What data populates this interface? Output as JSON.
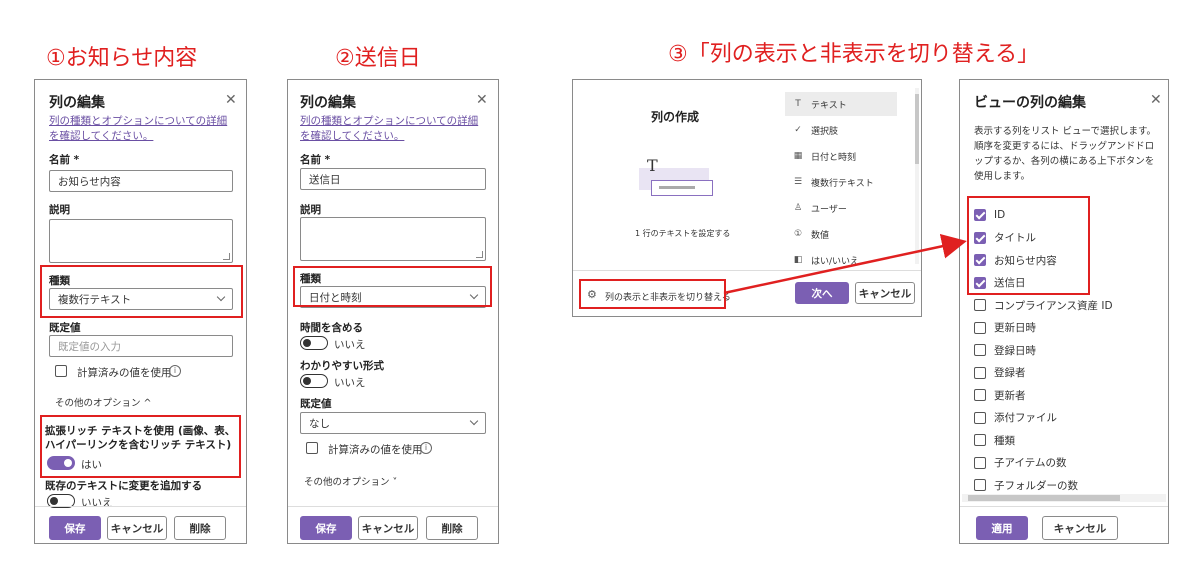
{
  "steps": {
    "s1": "①お知らせ内容",
    "s2": "②送信日",
    "s3": "③「列の表示と非表示を切り替える」"
  },
  "panel1": {
    "title": "列の編集",
    "help": "列の種類とオプションについての詳細を確認してください。",
    "name_label": "名前 *",
    "name_value": "お知らせ内容",
    "desc_label": "説明",
    "type_label": "種類",
    "type_value": "複数行テキスト",
    "default_label": "既定値",
    "default_placeholder": "既定値の入力",
    "calc_label": "計算済みの値を使用",
    "more_options": "その他のオプション ^",
    "rich_label": "拡張リッチ テキストを使用 (画像、表、ハイパーリンクを含むリッチ テキスト)",
    "rich_value": "はい",
    "append_label": "既存のテキストに変更を追加する",
    "append_value": "いいえ",
    "save": "保存",
    "cancel": "キャンセル",
    "delete": "削除"
  },
  "panel2": {
    "title": "列の編集",
    "help": "列の種類とオプションについての詳細を確認してください。",
    "name_label": "名前 *",
    "name_value": "送信日",
    "desc_label": "説明",
    "type_label": "種類",
    "type_value": "日付と時刻",
    "time_label": "時間を含める",
    "time_value": "いいえ",
    "friendly_label": "わかりやすい形式",
    "friendly_value": "いいえ",
    "default_label": "既定値",
    "default_value": "なし",
    "calc_label": "計算済みの値を使用",
    "more_options": "その他のオプション ˅",
    "save": "保存",
    "cancel": "キャンセル",
    "delete": "削除"
  },
  "panel3": {
    "title": "列の作成",
    "caption": "1 行のテキストを設定する",
    "types": [
      {
        "icon": "T",
        "label": "テキスト"
      },
      {
        "icon": "✓",
        "label": "選択肢"
      },
      {
        "icon": "▦",
        "label": "日付と時刻"
      },
      {
        "icon": "☰",
        "label": "複数行テキスト"
      },
      {
        "icon": "♙",
        "label": "ユーザー"
      },
      {
        "icon": "①",
        "label": "数値"
      },
      {
        "icon": "◧",
        "label": "はい/いいえ"
      }
    ],
    "toggle_link": "列の表示と非表示を切り替える",
    "next": "次へ",
    "cancel": "キャンセル"
  },
  "panel4": {
    "title": "ビューの列の編集",
    "desc": "表示する列をリスト ビューで選択します。順序を変更するには、ドラッグアンドドロップするか、各列の横にある上下ボタンを使用します。",
    "columns": [
      {
        "label": "ID",
        "checked": true
      },
      {
        "label": "タイトル",
        "checked": true
      },
      {
        "label": "お知らせ内容",
        "checked": true
      },
      {
        "label": "送信日",
        "checked": true
      },
      {
        "label": "コンプライアンス資産 ID",
        "checked": false
      },
      {
        "label": "更新日時",
        "checked": false
      },
      {
        "label": "登録日時",
        "checked": false
      },
      {
        "label": "登録者",
        "checked": false
      },
      {
        "label": "更新者",
        "checked": false
      },
      {
        "label": "添付ファイル",
        "checked": false
      },
      {
        "label": "種類",
        "checked": false
      },
      {
        "label": "子アイテムの数",
        "checked": false
      },
      {
        "label": "子フォルダーの数",
        "checked": false
      }
    ],
    "apply": "適用",
    "cancel": "キャンセル"
  },
  "colors": {
    "accent": "#7b5fb3",
    "highlight": "#e02020"
  }
}
